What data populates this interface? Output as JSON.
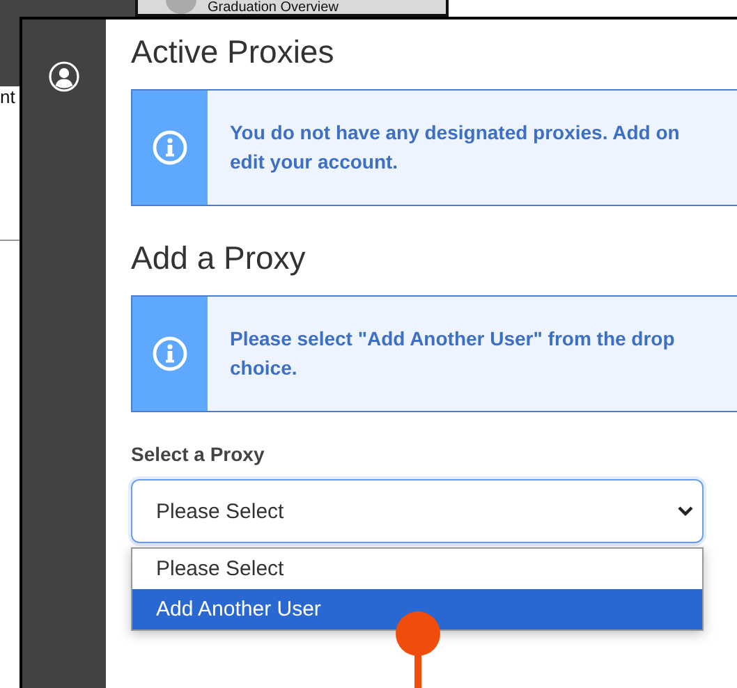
{
  "background": {
    "tab_title": "Graduation Overview",
    "side_text": "nt"
  },
  "sections": [
    {
      "title": "Active Proxies",
      "alert": {
        "lines": [
          "You do not have any designated proxies. Add on",
          "edit your account."
        ]
      }
    },
    {
      "title": "Add a Proxy",
      "alert": {
        "lines": [
          "Please select \"Add Another User\" from the drop",
          "choice."
        ]
      }
    }
  ],
  "select": {
    "label": "Select a Proxy",
    "value": "Please Select",
    "options": [
      {
        "label": "Please Select",
        "highlighted": false
      },
      {
        "label": "Add Another User",
        "highlighted": true
      }
    ]
  }
}
